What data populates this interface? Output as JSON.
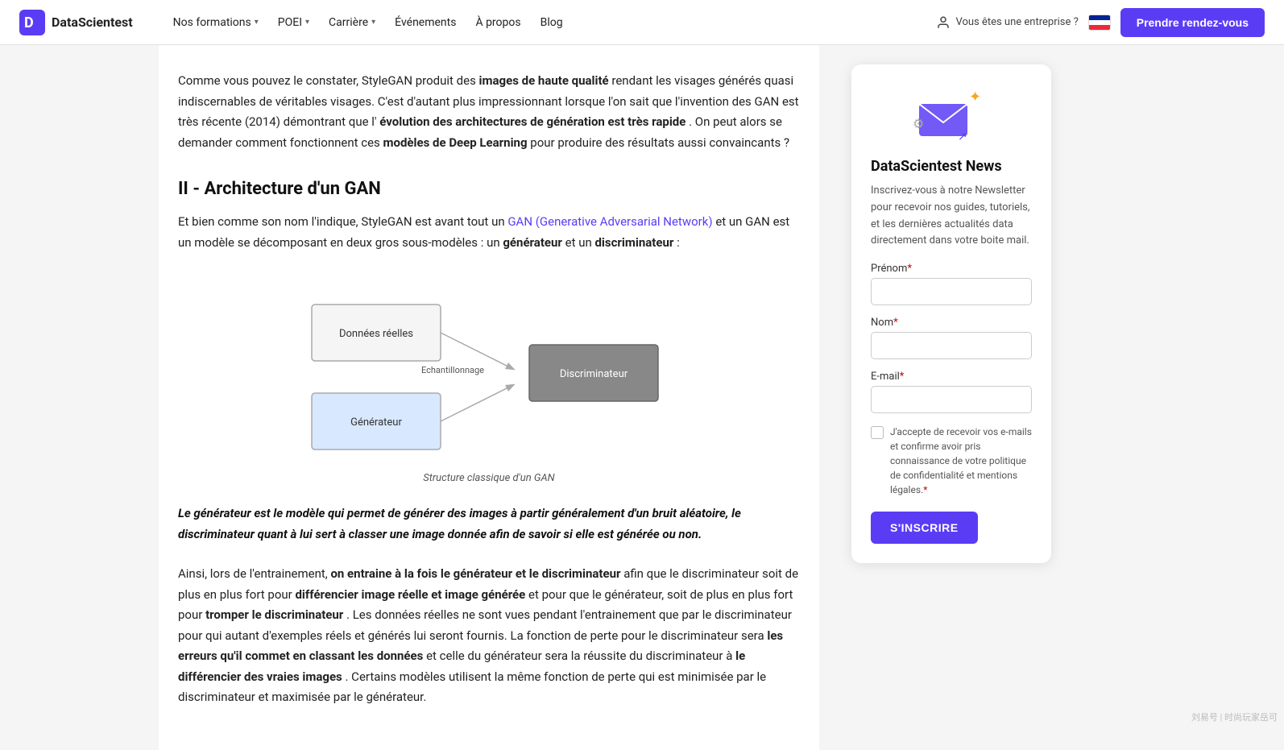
{
  "navbar": {
    "logo_text": "DataScientest",
    "links": [
      {
        "label": "Nos formations",
        "has_dropdown": true
      },
      {
        "label": "POEI",
        "has_dropdown": true
      },
      {
        "label": "Carrière",
        "has_dropdown": true
      },
      {
        "label": "Événements",
        "has_dropdown": false
      },
      {
        "label": "À propos",
        "has_dropdown": false
      },
      {
        "label": "Blog",
        "has_dropdown": false
      }
    ],
    "enterprise_label": "Vous êtes une entreprise ?",
    "cta_label": "Prendre rendez-vous"
  },
  "article": {
    "intro_text_1": "Comme vous pouvez le constater, StyleGAN produit des ",
    "intro_bold_1": "images de haute qualité",
    "intro_text_2": " rendant les visages générés quasi indiscernables de véritables visages. C'est d'autant plus impressionnant lorsque l'on sait que l'invention des GAN est très récente (2014) démontrant que l'",
    "intro_bold_2": "évolution des architectures de génération est très rapide",
    "intro_text_3": ". On peut alors se demander comment fonctionnent ces ",
    "intro_bold_3": "modèles de Deep Learning",
    "intro_text_4": " pour produire des résultats aussi convaincants ?",
    "section_heading": "II - Architecture d'un GAN",
    "para2_text_1": "Et bien comme son nom l'indique, StyleGAN est avant tout un ",
    "para2_link": "GAN (Generative Adversarial Network)",
    "para2_text_2": " et un GAN est un modèle se décomposant en deux gros sous-modèles : un ",
    "para2_bold_1": "générateur",
    "para2_text_3": " et un ",
    "para2_bold_2": "discriminateur",
    "para2_text_4": " :",
    "diagram_caption": "Structure classique d'un GAN",
    "diagram_labels": {
      "donnees_reelles": "Données réelles",
      "generateur": "Générateur",
      "echantillonnage": "Echantillonnage",
      "discriminateur": "Discriminateur"
    },
    "blockquote": "Le générateur est le modèle qui permet de générer des images à partir généralement d'un bruit aléatoire, le discriminateur quant à lui sert à classer une image donnée afin de savoir si elle est générée ou non.",
    "para3_text_1": "Ainsi, lors de l'entrainement, ",
    "para3_bold_1": "on entraine à la fois le générateur et le discriminateur",
    "para3_text_2": " afin que le discriminateur soit de plus en plus fort pour ",
    "para3_bold_2": "différencier image réelle et image générée",
    "para3_text_3": " et pour que le générateur, soit de plus en plus fort pour ",
    "para3_bold_3": "tromper le discriminateur",
    "para3_text_4": ". Les données réelles ne sont vues pendant l'entrainement que par le discriminateur pour qui autant d'exemples réels et générés lui seront fournis. La fonction de perte pour le discriminateur sera ",
    "para3_bold_4": "les erreurs qu'il commet en classant les données",
    "para3_text_5": " et celle du générateur sera la réussite du discriminateur à ",
    "para3_bold_5": "le différencier des vraies images",
    "para3_text_6": ". Certains modèles utilisent la même fonction de perte qui est minimisée par le discriminateur et maximisée par le générateur."
  },
  "sidebar": {
    "news_title": "DataScientest News",
    "news_desc": "Inscrivez-vous à notre Newsletter pour recevoir nos guides, tutoriels, et les dernières actualités data directement dans votre boite mail.",
    "form": {
      "prenom_label": "Prénom",
      "prenom_required": "*",
      "nom_label": "Nom",
      "nom_required": "*",
      "email_label": "E-mail",
      "email_required": "*",
      "checkbox_label": "J'accepte de recevoir vos e-mails et confirme avoir pris connaissance de votre politique de confidentialité et mentions légales.",
      "checkbox_required": "*",
      "submit_label": "S'INSCRIRE"
    }
  },
  "watermark": "刘易号 | 时尚玩家岳可"
}
